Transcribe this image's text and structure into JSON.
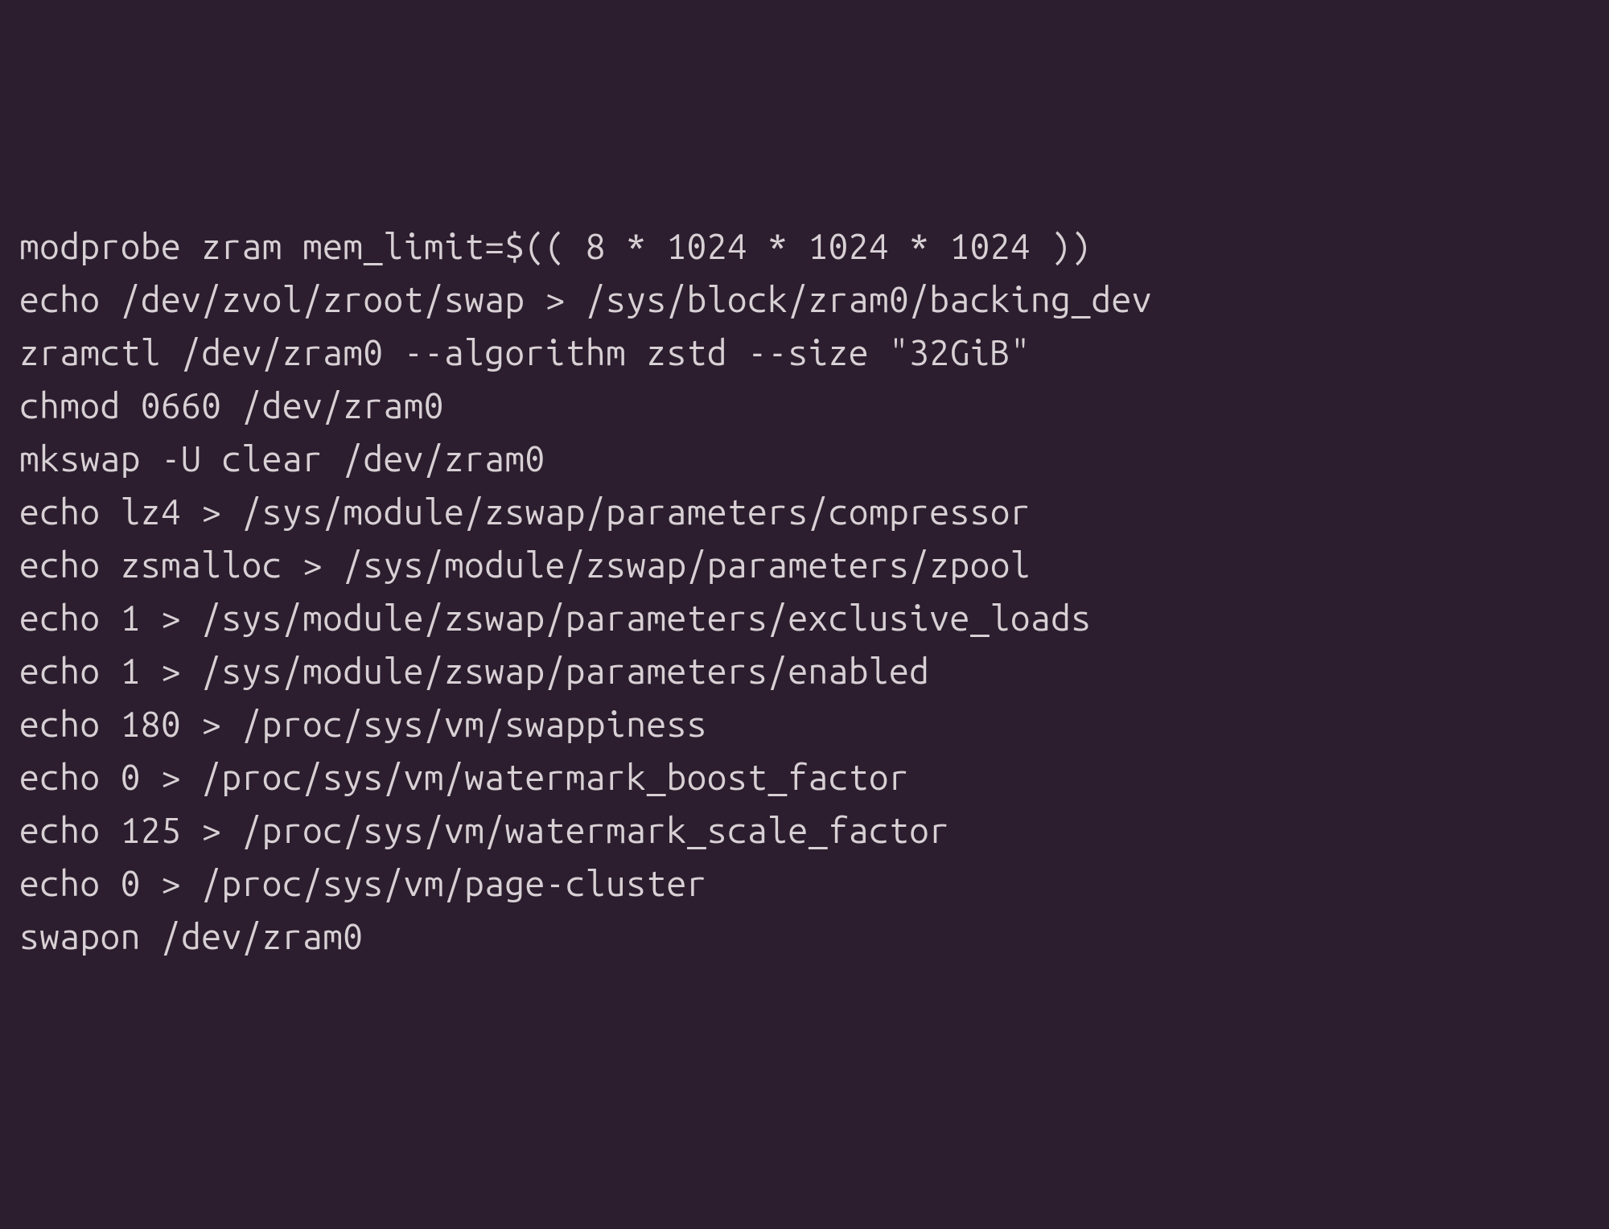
{
  "terminal": {
    "lines": [
      "modprobe zram mem_limit=$(( 8 * 1024 * 1024 * 1024 ))",
      "echo /dev/zvol/zroot/swap > /sys/block/zram0/backing_dev",
      "zramctl /dev/zram0 --algorithm zstd --size \"32GiB\"",
      "chmod 0660 /dev/zram0",
      "mkswap -U clear /dev/zram0",
      "echo lz4 > /sys/module/zswap/parameters/compressor",
      "echo zsmalloc > /sys/module/zswap/parameters/zpool",
      "echo 1 > /sys/module/zswap/parameters/exclusive_loads",
      "echo 1 > /sys/module/zswap/parameters/enabled",
      "echo 180 > /proc/sys/vm/swappiness",
      "echo 0 > /proc/sys/vm/watermark_boost_factor",
      "echo 125 > /proc/sys/vm/watermark_scale_factor",
      "echo 0 > /proc/sys/vm/page-cluster",
      "swapon /dev/zram0"
    ]
  }
}
